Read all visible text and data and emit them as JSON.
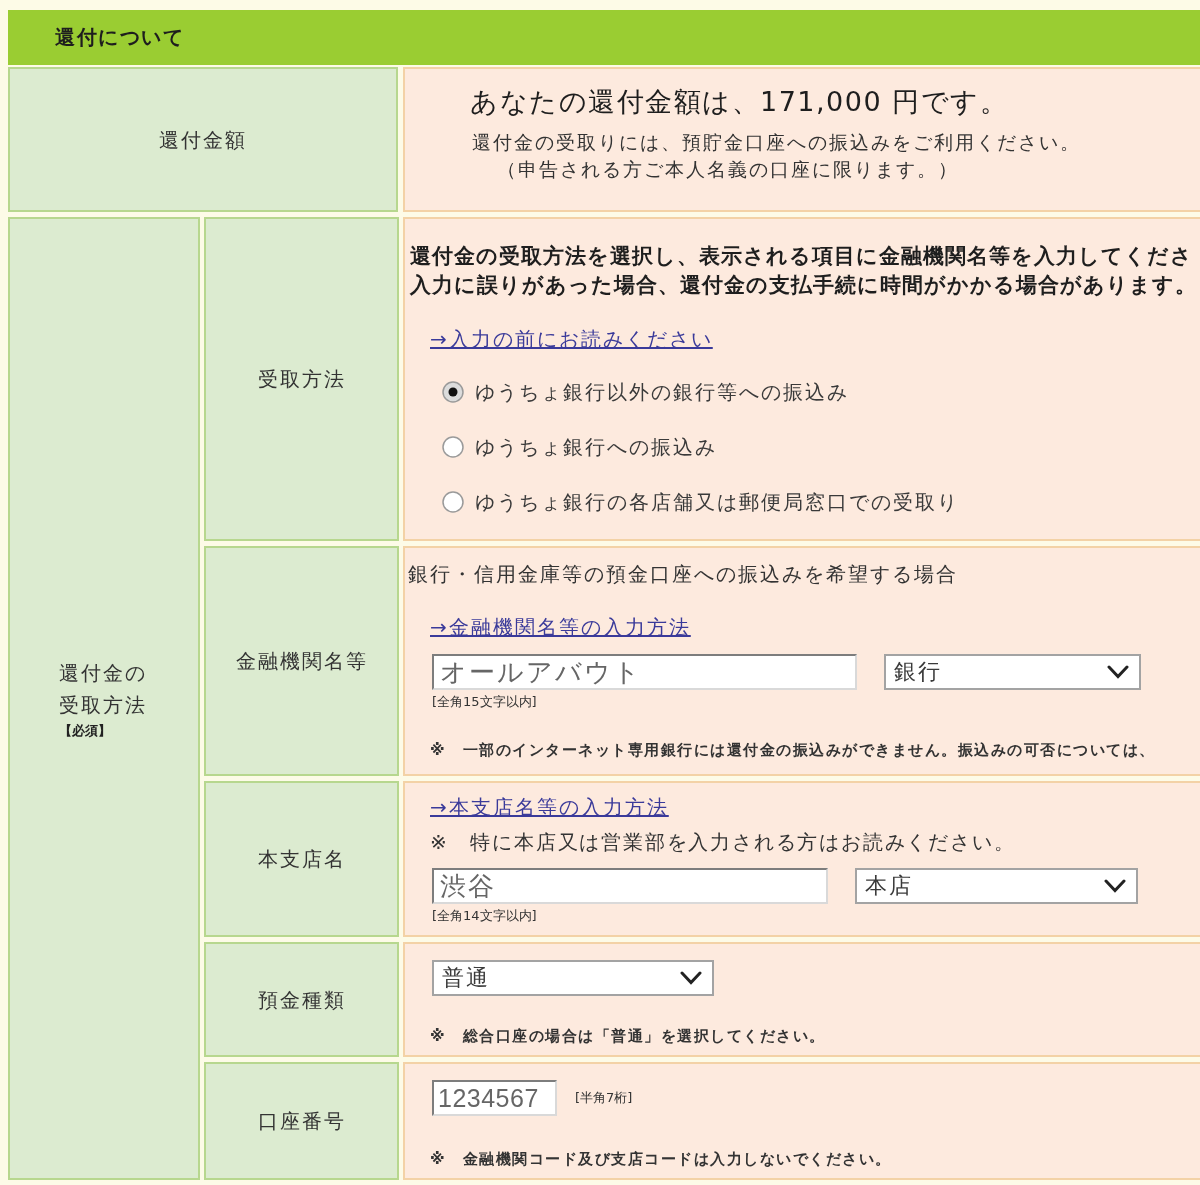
{
  "section": {
    "title": "還付について"
  },
  "refund_amount": {
    "label": "還付金額",
    "headline": "あなたの還付金額は、171,000 円です。",
    "notes": [
      "還付金の受取りには、預貯金口座への振込みをご利用ください。",
      "（申告される方ご本人名義の口座に限ります。）"
    ]
  },
  "receipt": {
    "label": "還付金の受取方法",
    "required": "【必須】",
    "rows": [
      {
        "kind": "method",
        "label": "受取方法",
        "items": [
          {
            "kind": "instruction",
            "lines": [
              "還付金の受取方法を選択し、表示される項目に金融機関名等を入力してくださ",
              "入力に誤りがあった場合、還付金の支払手続に時間がかかる場合があります。"
            ]
          },
          {
            "kind": "link",
            "text": "→入力の前にお読みください"
          },
          {
            "kind": "radios",
            "options": [
              {
                "label": "ゆうちょ銀行以外の銀行等への振込み",
                "selected": true
              },
              {
                "label": "ゆうちょ銀行への振込み",
                "selected": false
              },
              {
                "label": "ゆうちょ銀行の各店舗又は郵便局窓口での受取り",
                "selected": false
              }
            ]
          }
        ]
      },
      {
        "kind": "bank",
        "label": "金融機関名等",
        "items": [
          {
            "kind": "lead",
            "text": "銀行・信用金庫等の預金口座への振込みを希望する場合"
          },
          {
            "kind": "link",
            "text": "→金融機関名等の入力方法"
          },
          {
            "kind": "fields",
            "parts": [
              {
                "kind": "input",
                "value": "オールアバウト"
              },
              {
                "kind": "select",
                "value": "銀行"
              }
            ]
          },
          {
            "kind": "hint",
            "text": "[全角15文字以内]"
          },
          {
            "kind": "small_note",
            "text": "※　一部のインターネット専用銀行には還付金の振込みができません。振込みの可否については、"
          }
        ]
      },
      {
        "kind": "branch",
        "label": "本支店名",
        "items": [
          {
            "kind": "link",
            "text": "→本支店名等の入力方法"
          },
          {
            "kind": "notice",
            "text": "※　特に本店又は営業部を入力される方はお読みください。"
          },
          {
            "kind": "fields",
            "parts": [
              {
                "kind": "input",
                "value": "渋谷"
              },
              {
                "kind": "select",
                "value": "本店"
              }
            ]
          },
          {
            "kind": "hint",
            "text": "[全角14文字以内]"
          }
        ]
      },
      {
        "kind": "deposit_type",
        "label": "預金種類",
        "items": [
          {
            "kind": "fields",
            "parts": [
              {
                "kind": "select",
                "value": "普通"
              }
            ]
          },
          {
            "kind": "small_note",
            "text": "※　総合口座の場合は「普通」を選択してください。"
          }
        ]
      },
      {
        "kind": "account_number",
        "label": "口座番号",
        "items": [
          {
            "kind": "fields",
            "parts": [
              {
                "kind": "input",
                "value": "1234567"
              },
              {
                "kind": "hint",
                "text": "[半角7桁]"
              }
            ]
          },
          {
            "kind": "small_note",
            "text": "※　金融機関コード及び支店コードは入力しないでください。"
          }
        ]
      }
    ]
  }
}
